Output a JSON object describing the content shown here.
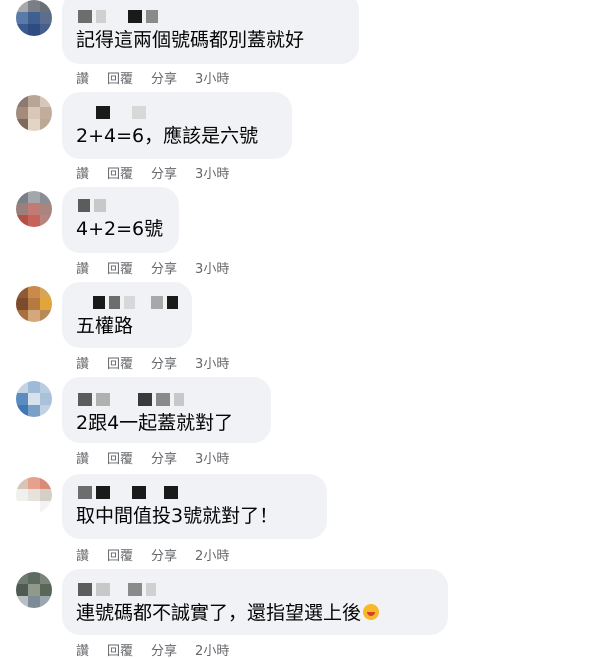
{
  "actions": {
    "like": "讚",
    "reply": "回覆",
    "share": "分享"
  },
  "comments": [
    {
      "text": "記得這兩個號碼都別蓋就好",
      "time": "3小時"
    },
    {
      "text": "2+4=6，應該是六號",
      "time": "3小時"
    },
    {
      "text": "4+2=6號",
      "time": "3小時"
    },
    {
      "text": "五權路",
      "time": "3小時"
    },
    {
      "text": "2跟4一起蓋就對了",
      "time": "3小時"
    },
    {
      "text": "取中間值投3號就對了！",
      "time": "2小時"
    },
    {
      "text": "連號碼都不誠實了，還指望選上後",
      "time": "2小時",
      "emoji": "rolling-laughing-emoji"
    }
  ]
}
